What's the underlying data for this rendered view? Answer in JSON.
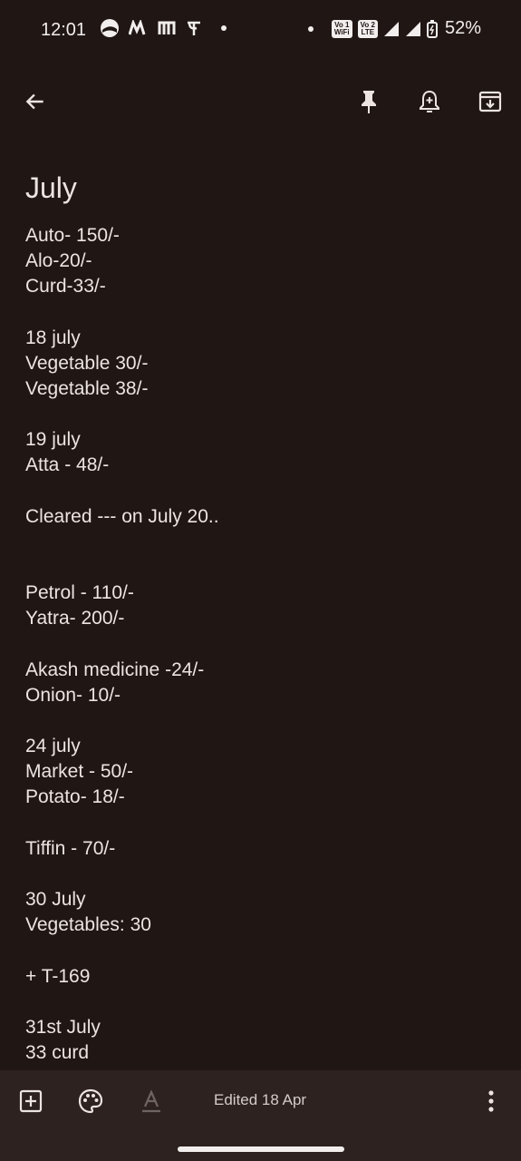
{
  "status_bar": {
    "time": "12:01",
    "battery": "52%",
    "badges": [
      "Vo1 WiFi",
      "Vo2 LTE"
    ],
    "icons": [
      "browser-icon",
      "m-app-icon",
      "m-app-icon-2",
      "phonepe-icon",
      "notification-dot",
      "dot",
      "wifi-calling-badge",
      "lte-badge",
      "signal-icon",
      "signal-roaming-icon",
      "battery-charging-icon"
    ]
  },
  "toolbar": {
    "icons": [
      "back-arrow-icon",
      "pin-icon",
      "reminder-bell-icon",
      "archive-icon"
    ]
  },
  "note": {
    "title": "July",
    "body": "Auto- 150/-\nAlo-20/-\nCurd-33/-\n\n18 july\nVegetable 30/-\nVegetable 38/-\n\n19 july\nAtta - 48/-\n\nCleared --- on July 20..\n\n\nPetrol - 110/-\nYatra- 200/-\n\nAkash medicine -24/-\nOnion- 10/-\n\n24 july\nMarket - 50/-\nPotato- 18/-\n\nTiffin - 70/-\n\n30 July\nVegetables: 30\n\n+ T-169\n\n31st July\n33 curd"
  },
  "bottom_bar": {
    "edited_text": "Edited 18 Apr",
    "icons": [
      "add-box-icon",
      "palette-icon",
      "text-format-icon",
      "more-vert-icon"
    ]
  },
  "colors": {
    "background": "#201614",
    "bottom_bar": "#2d221f",
    "text": "#ece4e1"
  }
}
